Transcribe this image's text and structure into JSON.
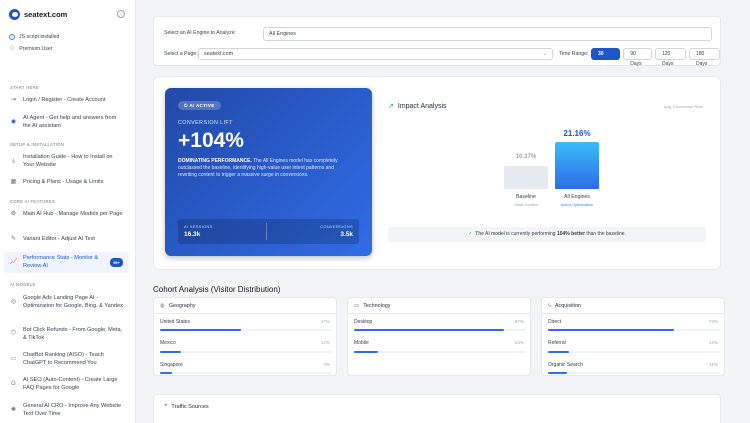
{
  "brand": {
    "name": "seatext.com"
  },
  "status": {
    "script": "JS script installed",
    "plan": "Premium User"
  },
  "sections": {
    "start": "START HERE",
    "setup": "SETUP & INSTALLATION",
    "core": "CORE AI FEATURES",
    "models": "AI MODELS"
  },
  "nav": {
    "login": "Login / Register - Create Account",
    "agent": "AI Agent - Get help and answers from the AI assistant",
    "install": "Installation Guide - How to Install on Your Website",
    "pricing": "Pricing & Plans - Usage & Limits",
    "hub": "Main AI Hub - Manage Models per Page",
    "variant": "Variant Editor - Adjust AI Text",
    "perf": "Performance Stats - Monitor & Review AI",
    "perf_badge": "99+",
    "ads": "Google Ads Landing Page AI - Optimization for Google, Bing, & Yandex",
    "bot": "Bot Click Refunds - From Google, Meta, & TikTok",
    "chatbot": "ChatBot Ranking (AISO) - Teach ChatGPT to Recommend You",
    "seo": "AI SEO (Auto-Content) - Create Large FAQ Pages for Google",
    "cro": "General AI CRO - Improve Any Website Text Over Time"
  },
  "filters": {
    "engine_label": "Select an AI Engine to Analyze:",
    "engine_value": "All Engines",
    "page_label": "Select a Page:",
    "page_value": "seatext.com",
    "range_label": "Time Range:",
    "ranges": [
      "30 Days",
      "90 Days",
      "120 Days",
      "180 Days"
    ],
    "active_range": "30 Days"
  },
  "hero": {
    "pill": "AI ACTIVE",
    "conv_label": "CONVERSION LIFT",
    "conv_value": "+104%",
    "desc_bold": "DOMINATING PERFORMANCE.",
    "desc_rest": " The All Engines model has completely outclassed the baseline, identifying high-value user intent patterns and rewriting content to trigger a massive surge in conversions.",
    "sessions_label": "AI SESSIONS",
    "sessions_value": "16.3k",
    "conversions_label": "CONVERSIONS",
    "conversions_value": "3.5k"
  },
  "impact": {
    "title": "Impact Analysis",
    "legend": "Avg. Conversion Rate",
    "baseline_pct": "10.37%",
    "baseline_label": "Baseline",
    "baseline_sub": "Static Content",
    "ai_pct": "21.16%",
    "ai_label": "All Engines",
    "ai_sub": "Active Optimization",
    "note_pre": "The AI model is currently performing ",
    "note_bold": "104% better",
    "note_post": " than the baseline.",
    "baseline_rate": 10.37,
    "ai_rate": 21.16
  },
  "cohort": {
    "title": "Cohort Analysis (Visitor Distribution)",
    "geo": {
      "title": "Geography",
      "rows": [
        {
          "label": "United States",
          "pct": "47%",
          "value": 47
        },
        {
          "label": "Mexico",
          "pct": "12%",
          "value": 12
        },
        {
          "label": "Singapore",
          "pct": "7%",
          "value": 7
        }
      ]
    },
    "tech": {
      "title": "Technology",
      "rows": [
        {
          "label": "Desktop",
          "pct": "87%",
          "value": 87
        },
        {
          "label": "Mobile",
          "pct": "14%",
          "value": 14
        }
      ]
    },
    "acq": {
      "title": "Acquisition",
      "rows": [
        {
          "label": "Direct",
          "pct": "73%",
          "value": 73
        },
        {
          "label": "Referral",
          "pct": "12%",
          "value": 12
        },
        {
          "label": "Organic Search",
          "pct": "11%",
          "value": 11
        }
      ]
    }
  },
  "traffic": {
    "title": "Traffic Sources"
  },
  "colors": {
    "accent": "#1e56c7",
    "success": "#10b981",
    "bar_base": "#e5e9f0",
    "bar_ai": "#2fa7f0"
  }
}
